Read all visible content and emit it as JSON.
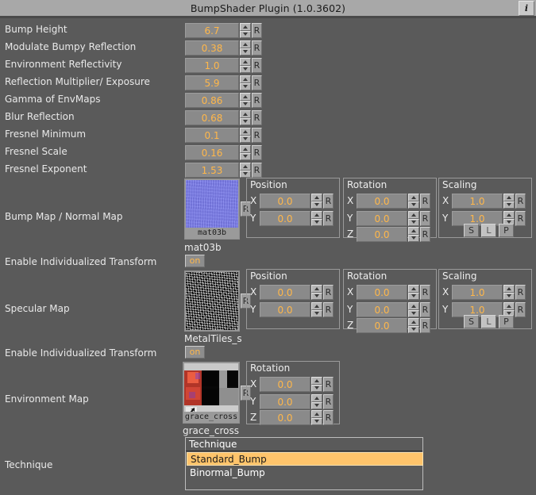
{
  "window": {
    "title": "BumpShader Plugin (1.0.3602)",
    "info_icon": "info-icon",
    "info_label": "i"
  },
  "params": [
    {
      "label": "Bump Height",
      "value": "6.7",
      "reset": "R"
    },
    {
      "label": "Modulate Bumpy Reflection",
      "value": "0.38",
      "reset": "R"
    },
    {
      "label": "Environment Reflectivity",
      "value": "1.0",
      "reset": "R"
    },
    {
      "label": "Reflection Multiplier/ Exposure",
      "value": "5.9",
      "reset": "R"
    },
    {
      "label": "Gamma of EnvMaps",
      "value": "0.86",
      "reset": "R"
    },
    {
      "label": "Blur Reflection",
      "value": "0.68",
      "reset": "R"
    },
    {
      "label": "Fresnel Minimum",
      "value": "0.1",
      "reset": "R"
    },
    {
      "label": "Fresnel Scale",
      "value": "0.16",
      "reset": "R"
    },
    {
      "label": "Fresnel Exponent",
      "value": "1.53",
      "reset": "R"
    }
  ],
  "bump_map": {
    "label": "Bump Map / Normal Map",
    "thumb_caption": "mat03b",
    "name": "mat03b",
    "reset": "R",
    "position": {
      "title": "Position",
      "axes": [
        "X",
        "Y"
      ],
      "values": [
        "0.0",
        "0.0"
      ],
      "reset": "R"
    },
    "rotation": {
      "title": "Rotation",
      "axes": [
        "X",
        "Y",
        "Z"
      ],
      "values": [
        "0.0",
        "0.0",
        "0.0"
      ],
      "reset": "R"
    },
    "scaling": {
      "title": "Scaling",
      "axes": [
        "X",
        "Y"
      ],
      "values": [
        "1.0",
        "1.0"
      ],
      "reset": "R",
      "modes": [
        "S",
        "L",
        "P"
      ],
      "active_mode": "L"
    }
  },
  "bump_transform_toggle": {
    "label": "Enable Individualized Transform",
    "state": "on"
  },
  "specular_map": {
    "label": "Specular Map",
    "thumb_caption": "",
    "name": "MetalTiles_s",
    "reset": "R",
    "position": {
      "title": "Position",
      "axes": [
        "X",
        "Y"
      ],
      "values": [
        "0.0",
        "0.0"
      ],
      "reset": "R"
    },
    "rotation": {
      "title": "Rotation",
      "axes": [
        "X",
        "Y",
        "Z"
      ],
      "values": [
        "0.0",
        "0.0",
        "0.0"
      ],
      "reset": "R"
    },
    "scaling": {
      "title": "Scaling",
      "axes": [
        "X",
        "Y"
      ],
      "values": [
        "1.0",
        "1.0"
      ],
      "reset": "R",
      "modes": [
        "S",
        "L",
        "P"
      ],
      "active_mode": "L"
    }
  },
  "specular_transform_toggle": {
    "label": "Enable Individualized Transform",
    "state": "on"
  },
  "environment_map": {
    "label": "Environment Map",
    "thumb_caption": "grace_cross",
    "name": "grace_cross",
    "reset": "R",
    "rotation": {
      "title": "Rotation",
      "axes": [
        "X",
        "Y",
        "Z"
      ],
      "values": [
        "0.0",
        "0.0",
        "0.0"
      ],
      "reset": "R"
    }
  },
  "technique": {
    "label": "Technique",
    "header": "Technique",
    "options": [
      "Standard_Bump",
      "Binormal_Bump"
    ],
    "selected": "Standard_Bump"
  },
  "colors": {
    "value_text": "#ffb74a",
    "selection": "#ffc46b",
    "background": "#5a5a5a",
    "titlebar": "#a8a8a8"
  }
}
